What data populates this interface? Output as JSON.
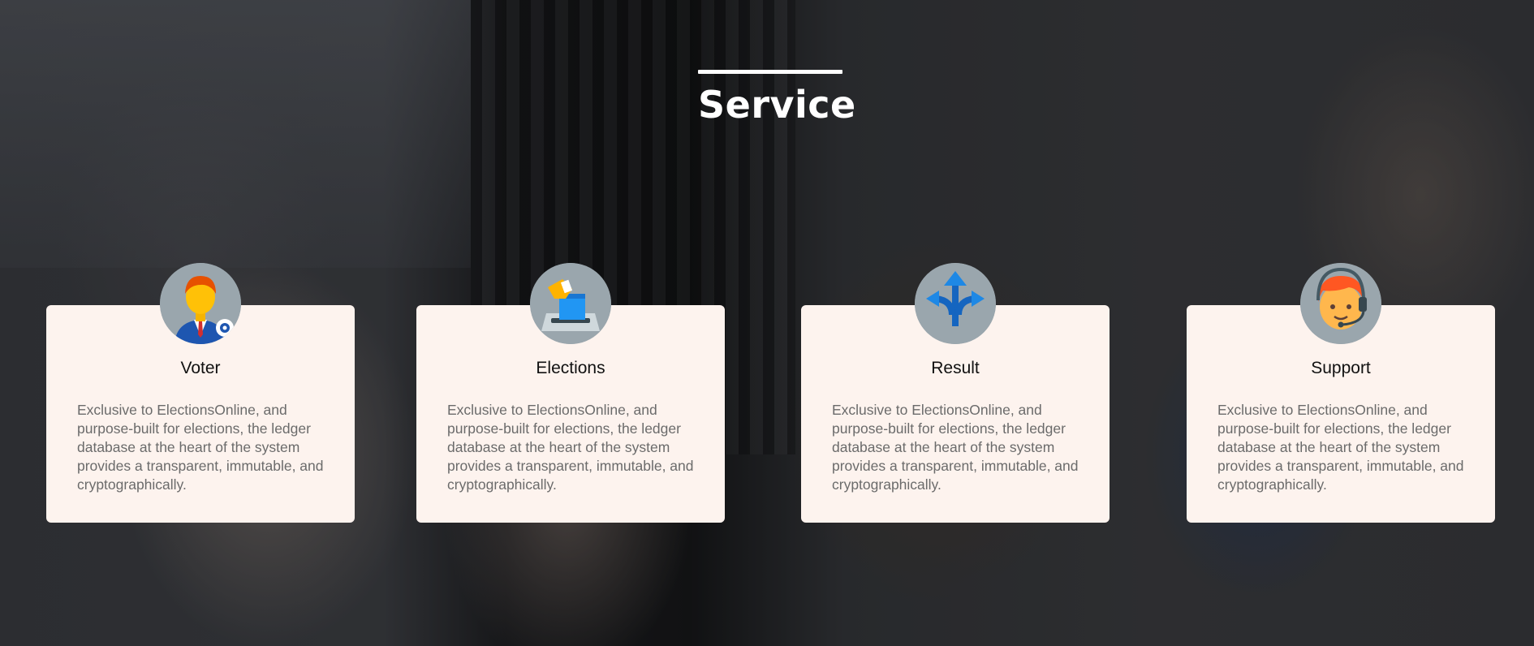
{
  "section": {
    "title": "Service"
  },
  "cards": [
    {
      "icon": "voter-user-icon",
      "title": "Voter",
      "text": "Exclusive to ElectionsOnline, and purpose-built for elections, the ledger database at the heart of the system provides a transparent, immutable, and cryptographically."
    },
    {
      "icon": "ballot-box-icon",
      "title": "Elections",
      "text": "Exclusive to ElectionsOnline, and purpose-built for elections, the ledger database at the heart of the system provides a transparent, immutable, and cryptographically."
    },
    {
      "icon": "split-arrows-icon",
      "title": "Result",
      "text": "Exclusive to ElectionsOnline, and purpose-built for elections, the ledger database at the heart of the system provides a transparent, immutable, and cryptographically."
    },
    {
      "icon": "support-headset-icon",
      "title": "Support",
      "text": "Exclusive to ElectionsOnline, and purpose-built for elections, the ledger database at the heart of the system provides a transparent, immutable, and cryptographically."
    }
  ],
  "colors": {
    "card_background": "#fdf3ee",
    "icon_circle": "#9aa6ad",
    "title_text": "#ffffff",
    "body_text": "#6b6b6b"
  }
}
